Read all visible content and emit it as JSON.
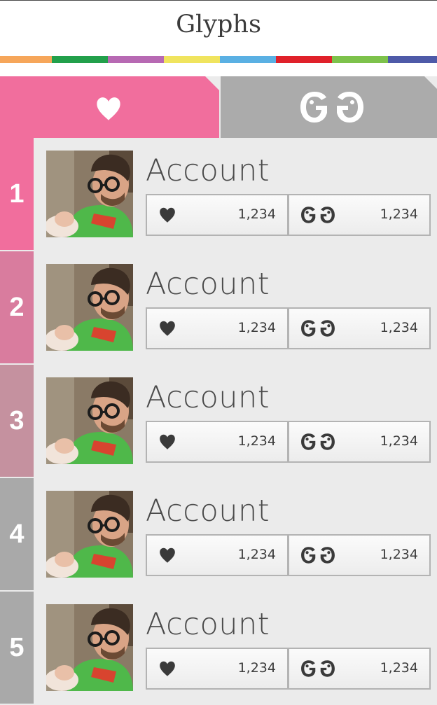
{
  "header": {
    "title": "Glyphs"
  },
  "colors": {
    "stripe": [
      "#f6a65a",
      "#22a04b",
      "#b769b3",
      "#f0e45e",
      "#5ab0e3",
      "#e0212a",
      "#7dc24b",
      "#4e5aa8"
    ],
    "tab_hearts_bg": "#f16e9d",
    "tab_glyphs_bg": "#ababab",
    "rank_colors": [
      "#f16e9d",
      "#d97c9e",
      "#c5919f",
      "#a9a9a9",
      "#a9a9a9"
    ]
  },
  "tabs": [
    {
      "icon": "heart-icon"
    },
    {
      "icon": "glyphs-logo-icon"
    }
  ],
  "rows": [
    {
      "rank": "1",
      "name": "Account",
      "likes": "1,234",
      "glyphs": "1,234"
    },
    {
      "rank": "2",
      "name": "Account",
      "likes": "1,234",
      "glyphs": "1,234"
    },
    {
      "rank": "3",
      "name": "Account",
      "likes": "1,234",
      "glyphs": "1,234"
    },
    {
      "rank": "4",
      "name": "Account",
      "likes": "1,234",
      "glyphs": "1,234"
    },
    {
      "rank": "5",
      "name": "Account",
      "likes": "1,234",
      "glyphs": "1,234"
    }
  ]
}
